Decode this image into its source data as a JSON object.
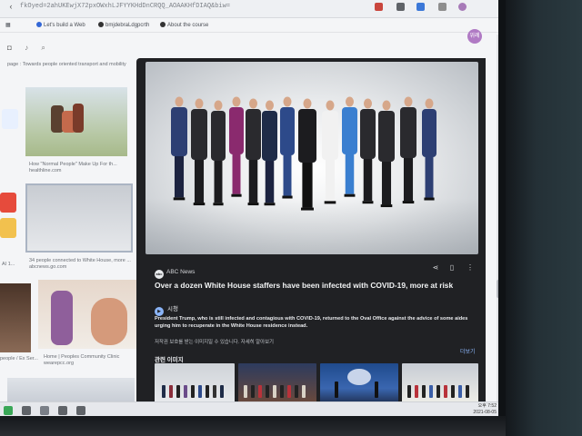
{
  "browser": {
    "url_fragment": "fkOyed=2ahUKEwjX72pxOWxhLJFYYKHdDnCRQQ_AOAAKHfDIAQ&biw=",
    "bookmarks": [
      "Let's build a Web",
      "bmjdebraLdgpcrth",
      "About the course"
    ],
    "profile_initial": "위례"
  },
  "results": [
    {
      "caption": "page : Towards people oriented transport and mobility"
    },
    {
      "caption": "How \"Normal People\" Make Up For th...",
      "source": "healthline.com"
    },
    {
      "caption": "34 people connected to White House, more ...",
      "source": "abcnews.go.com"
    },
    {
      "caption": "Home | Peoples Community Clinic",
      "source": "wearepcc.org"
    },
    {
      "caption": "people / Ex Ser..."
    },
    {
      "caption": "AI 1..."
    }
  ],
  "panel": {
    "source": "ABC News",
    "headline": "Over a dozen White House staffers have been infected with COVID-19, more at risk",
    "visit_label": "시청",
    "snippet": "President Trump, who is still infected and contagious with COVID-19, returned to the Oval Office against the advice of some aides urging him to recuperate in the White House residence instead.",
    "notice": "저작권 보호를 받는 이미지일 수 있습니다. 자세히 알아보기",
    "more_label": "더보기",
    "related_title": "관련 이미지"
  },
  "taskbar": {
    "time": "오후 7:52",
    "date": "2021-08-05"
  },
  "colors": {
    "panel_bg": "#202124",
    "link": "#8ab4f8",
    "headline": "#f1f3f4"
  }
}
